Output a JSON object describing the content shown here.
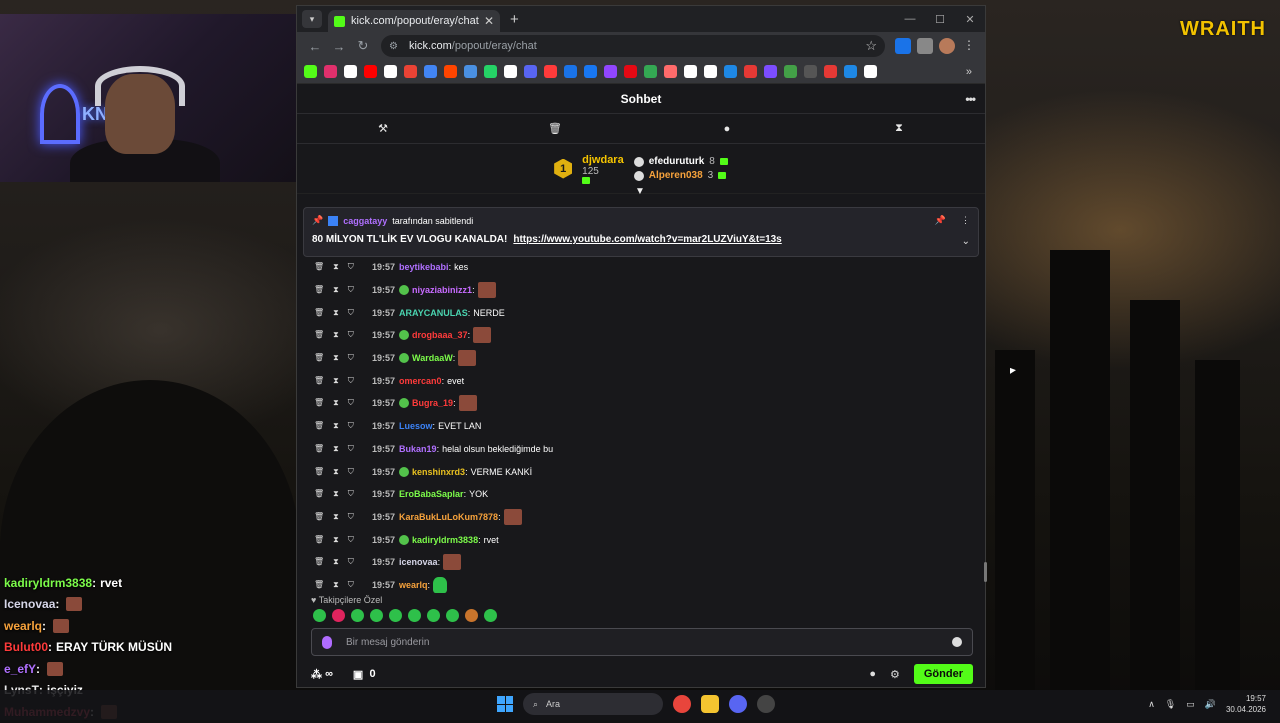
{
  "stream": {
    "logo": "WRAITH",
    "webcam_text": "KN"
  },
  "overlay_chat": [
    {
      "user": "kadiryldrm3838",
      "color": "#7cfc4a",
      "text": "rvet",
      "emote": false
    },
    {
      "user": "Icenovaa",
      "color": "#d6d6e8",
      "text": "",
      "emote": true
    },
    {
      "user": "wearlq",
      "color": "#f6a23c",
      "text": "",
      "emote": true
    },
    {
      "user": "Bulut00",
      "color": "#ff3b3b",
      "text": "ERAY TÜRK MÜSÜN",
      "emote": false
    },
    {
      "user": "e_efY",
      "color": "#b070ff",
      "text": "",
      "emote": true
    },
    {
      "user": "LynsT",
      "color": "#e8e8e8",
      "text": "işçiyiz",
      "emote": false
    },
    {
      "user": "Muhammedzvy",
      "color": "#ff4b6a",
      "text": "",
      "emote": true
    }
  ],
  "browser": {
    "tab_title": "kick.com/popout/eray/chat",
    "url_domain": "kick.com",
    "url_path": "/popout/eray/chat",
    "bookmark_colors": [
      "#53fc18",
      "#e1306c",
      "#ffffff",
      "#ff0000",
      "#ffffff",
      "#ea4335",
      "#4285f4",
      "#ff4500",
      "#4a90e2",
      "#25d366",
      "#ffffff",
      "#5865f2",
      "#ff3b3b",
      "#1a73e8",
      "#1877f2",
      "#9146ff",
      "#e50914",
      "#34a853",
      "#ff6b6b",
      "#ffffff",
      "#ffffff",
      "#1e88e5",
      "#e53935",
      "#7c4dff",
      "#43a047",
      "#555555",
      "#e53935",
      "#1e88e5",
      "#ffffff"
    ]
  },
  "chat": {
    "title": "Sohbet",
    "top_gifter": {
      "rank": "1",
      "name": "djwdara",
      "count": "125"
    },
    "supporters": [
      {
        "name": "efeduruturk",
        "count": "8",
        "color": "#ffffff"
      },
      {
        "name": "Alperen038",
        "count": "3",
        "color": "#f6a23c"
      }
    ],
    "pinned": {
      "by": "caggatayy",
      "by_suffix": "tarafından sabitlendi",
      "text": "80 MİLYON TL'LİK EV VLOGU KANALDA!",
      "link": "https://www.youtube.com/watch?v=mar2LUZViuY&t=13s"
    },
    "messages": [
      {
        "time": "19:57",
        "user": "beytikebabi",
        "color": "#b070ff",
        "text": "kes",
        "badge": false,
        "emote": false
      },
      {
        "time": "19:57",
        "user": "niyaziabinizz1",
        "color": "#c76bff",
        "text": "",
        "badge": true,
        "emote": true
      },
      {
        "time": "19:57",
        "user": "ARAYCANULAS",
        "color": "#4ad4b0",
        "text": "NERDE",
        "badge": false,
        "emote": false
      },
      {
        "time": "19:57",
        "user": "drogbaaa_37",
        "color": "#ff3b3b",
        "text": "",
        "badge": true,
        "emote": true
      },
      {
        "time": "19:57",
        "user": "WardaaW",
        "color": "#7cfc4a",
        "text": "",
        "badge": true,
        "emote": true
      },
      {
        "time": "19:57",
        "user": "omercan0",
        "color": "#ff3b3b",
        "text": "evet",
        "badge": false,
        "emote": false
      },
      {
        "time": "19:57",
        "user": "Bugra_19",
        "color": "#ff3b3b",
        "text": "",
        "badge": true,
        "emote": true
      },
      {
        "time": "19:57",
        "user": "Luesow",
        "color": "#3b82f6",
        "text": "EVET LAN",
        "badge": false,
        "emote": false
      },
      {
        "time": "19:57",
        "user": "Bukan19",
        "color": "#b070ff",
        "text": "helal olsun beklediğimde bu",
        "badge": false,
        "emote": false
      },
      {
        "time": "19:57",
        "user": "kenshinxrd3",
        "color": "#e8c020",
        "text": "VERME KANKİ",
        "badge": true,
        "emote": false
      },
      {
        "time": "19:57",
        "user": "EroBabaSaplar",
        "color": "#7cfc4a",
        "text": "YOK",
        "badge": false,
        "emote": false
      },
      {
        "time": "19:57",
        "user": "KaraBukLuLoKum7878",
        "color": "#f6a23c",
        "text": "",
        "badge": false,
        "emote": true
      },
      {
        "time": "19:57",
        "user": "kadiryldrm3838",
        "color": "#7cfc4a",
        "text": "rvet",
        "badge": true,
        "emote": false
      },
      {
        "time": "19:57",
        "user": "icenovaa",
        "color": "#d6d6e8",
        "text": "",
        "badge": false,
        "emote": true
      },
      {
        "time": "19:57",
        "user": "wearlq",
        "color": "#f6a23c",
        "text": "",
        "badge": false,
        "emote": "green"
      }
    ],
    "followers_only_label": "Takipçilere Özel",
    "input_placeholder": "Bir mesaj gönderin",
    "viewer_label": "∞",
    "gift_count": "0",
    "send_label": "Gönder"
  },
  "taskbar": {
    "search_label": "Ara",
    "time": "19:57",
    "date": "30.04.2026"
  }
}
